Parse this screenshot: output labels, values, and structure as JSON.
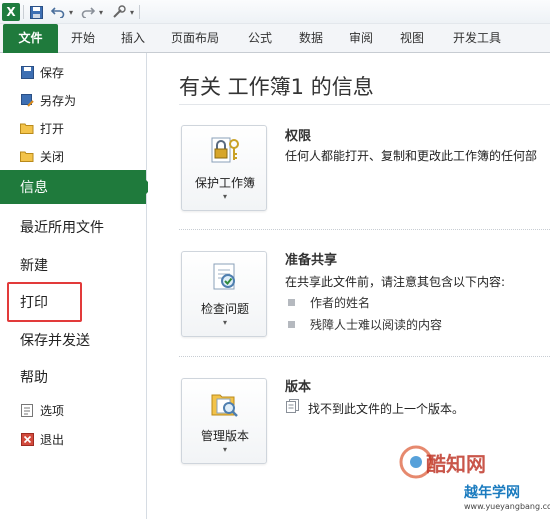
{
  "app": {
    "logo_letter": "X"
  },
  "qat": {
    "icons": [
      "save-icon",
      "undo-icon",
      "redo-icon",
      "customize-icon"
    ]
  },
  "ribbon": {
    "tabs": [
      "文件",
      "开始",
      "插入",
      "页面布局",
      "公式",
      "数据",
      "审阅",
      "视图",
      "开发工具"
    ]
  },
  "nav": {
    "save": "保存",
    "save_as": "另存为",
    "open": "打开",
    "close": "关闭",
    "info": "信息",
    "recent": "最近所用文件",
    "new": "新建",
    "print": "打印",
    "save_send": "保存并发送",
    "help": "帮助",
    "options": "选项",
    "exit": "退出"
  },
  "info": {
    "title": "有关 工作簿1 的信息",
    "permissions": {
      "button": "保护工作簿",
      "heading": "权限",
      "text": "任何人都能打开、复制和更改此工作簿的任何部"
    },
    "prepare": {
      "button": "检查问题",
      "heading": "准备共享",
      "text": "在共享此文件前，请注意其包含以下内容:",
      "bullets": [
        "作者的姓名",
        "残障人士难以阅读的内容"
      ]
    },
    "versions": {
      "button": "管理版本",
      "heading": "版本",
      "text": "找不到此文件的上一个版本。"
    }
  },
  "watermark": {
    "name1": "酷知网",
    "name2": "越年学网",
    "url": "www.yueyangbang.com"
  },
  "colors": {
    "accent": "#1f7a3c",
    "highlight": "#e23a3a"
  }
}
